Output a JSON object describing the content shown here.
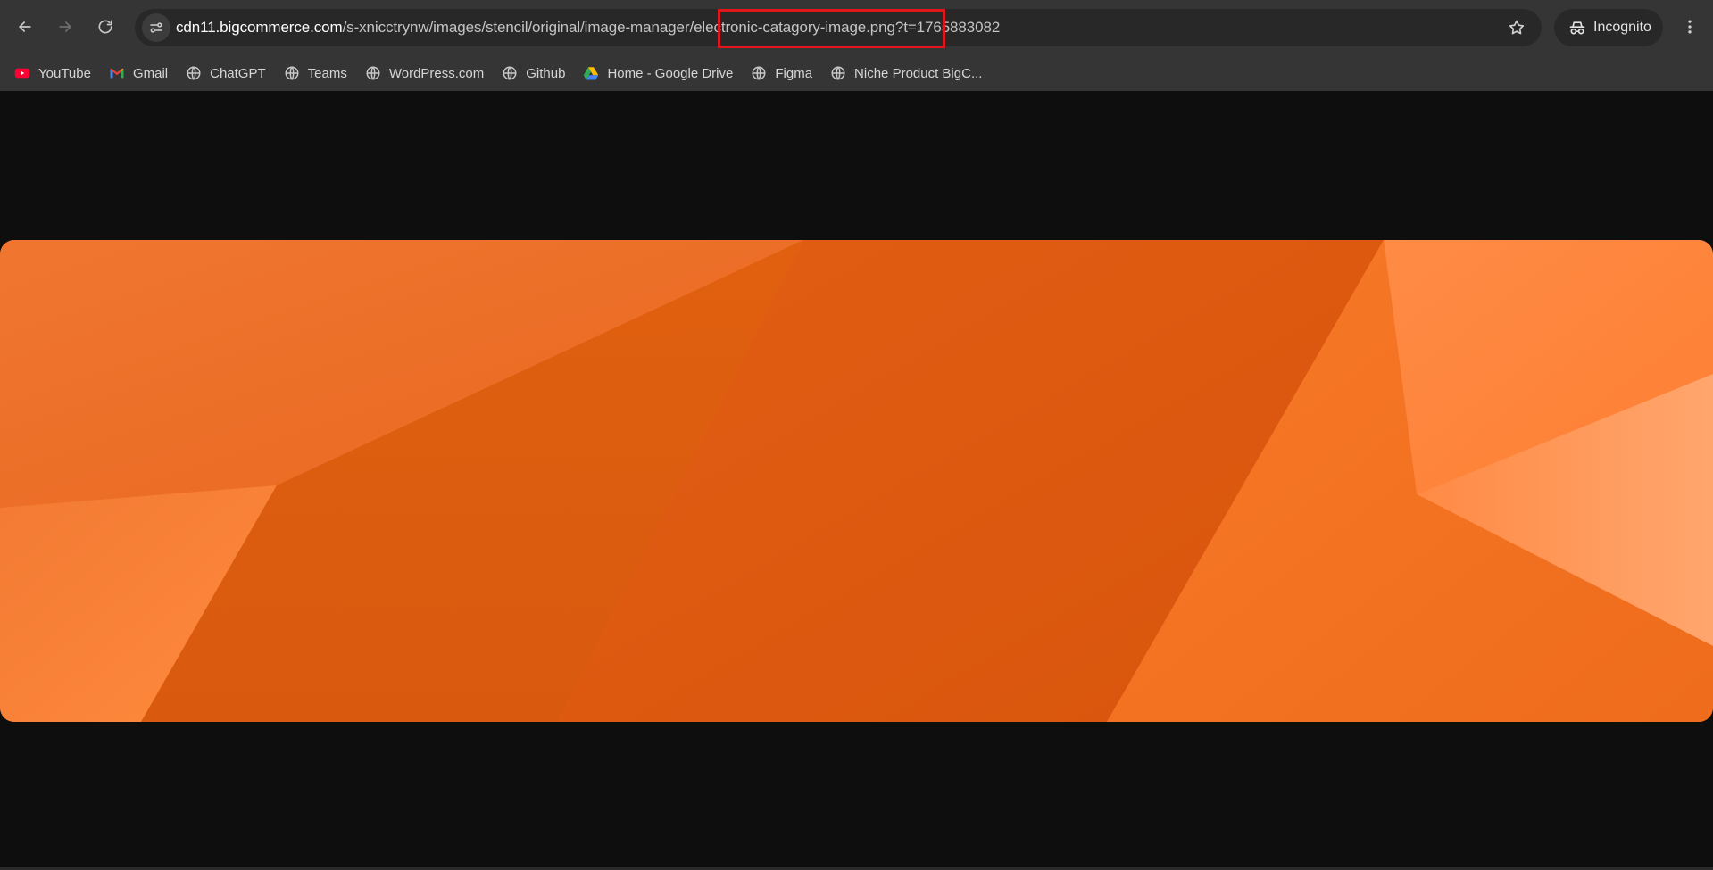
{
  "browser": {
    "url": {
      "host": "cdn11.bigcommerce.com",
      "path": "/s-xnicctrynw/images/stencil/original/image-manager/electronic-catagory-image.png?t=1765883082"
    },
    "profile_label": "Incognito",
    "highlight_color": "#e0161b"
  },
  "navigation": {
    "back_icon": "back-arrow-icon",
    "forward_icon": "forward-arrow-icon",
    "reload_icon": "reload-icon"
  },
  "bookmarks": [
    {
      "label": "YouTube",
      "icon": "youtube-icon"
    },
    {
      "label": "Gmail",
      "icon": "gmail-icon"
    },
    {
      "label": "ChatGPT",
      "icon": "globe-icon"
    },
    {
      "label": "Teams",
      "icon": "globe-icon"
    },
    {
      "label": "WordPress.com",
      "icon": "globe-icon"
    },
    {
      "label": "Github",
      "icon": "globe-icon"
    },
    {
      "label": "Home - Google Drive",
      "icon": "google-drive-icon"
    },
    {
      "label": "Figma",
      "icon": "globe-icon"
    },
    {
      "label": "Niche Product BigC..."
    }
  ],
  "image": {
    "colors": {
      "base": "#ea6a22",
      "dark": "#d9560e",
      "light": "#ff9a5a"
    }
  }
}
